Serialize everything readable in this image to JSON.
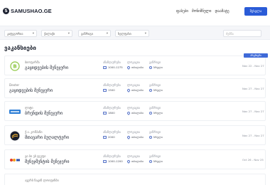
{
  "header": {
    "logo_text": "SAMUSHAO.GE",
    "logo_letter": "S",
    "nav": [
      "ფასები",
      "მონიშნული",
      "დაამატე"
    ],
    "login_label": "შესვლა"
  },
  "filters": {
    "items": [
      "კატეგორია",
      "ქალაქი",
      "განრიგი",
      "ხელფასი"
    ],
    "search_placeholder": "ძებნა"
  },
  "section": {
    "title": "ვაკანსიები"
  },
  "columns": {
    "salary": "ანაზღაურება",
    "location": "ლოკაცია",
    "schedule": "განრიგი"
  },
  "jobs": [
    {
      "company": "ბიოფარმა",
      "title": "გაყიდვების მენეჯერი",
      "salary": "1000-1275",
      "location": "თბილისი",
      "schedule": "სრული",
      "dates": "Nov 22 - Nov 27",
      "badge": "პრემიუმი",
      "logo_color": "#8cc63f"
    },
    {
      "company": "Dexter",
      "title": "გაყიდვების მენეჯერი",
      "salary": "1500",
      "location": "თბილისი",
      "schedule": "სრული",
      "dates": "Nov 27 - Nov 27",
      "badge": "",
      "logo_color": ""
    },
    {
      "company": "ლიტი",
      "title": "ბრენდის მენეჯერი",
      "salary": "1800",
      "location": "თბილისი",
      "schedule": "სრული",
      "dates": "Nov 27 - Nov 27",
      "badge": "",
      "logo_color": "#2f7fd6"
    },
    {
      "company": "ქ.ა. კომპანი",
      "title": "მთავარი ბუღალტერი",
      "salary": "2000",
      "location": "თბილისი",
      "schedule": "სრული",
      "dates": "Nov 27 - Nov 27",
      "badge": "",
      "logo_color": "#1a1f2e"
    },
    {
      "company": "გი ბი ეს ჯგუფი",
      "title": "მენეჯმენტის მენეჯერი",
      "salary": "1000-1200",
      "location": "თბილისი",
      "schedule": "სრული",
      "dates": "Oct 26 - Nov 25",
      "badge": "",
      "logo_color": "#e23b2b"
    },
    {
      "company": "ავერს ნაცინ ლოიფინბი",
      "title": "",
      "salary": "",
      "location": "",
      "schedule": "",
      "dates": "",
      "badge": "",
      "logo_color": ""
    }
  ]
}
